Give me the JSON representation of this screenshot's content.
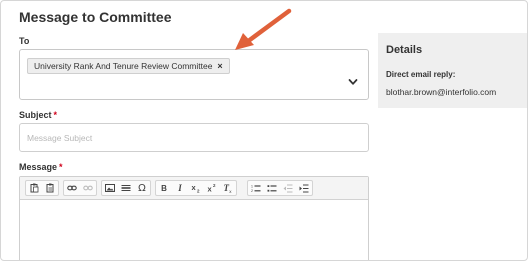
{
  "form": {
    "title": "Message to Committee",
    "to_label": "To",
    "recipient_chip": "University Rank And Tenure Review Committee",
    "chip_remove": "×",
    "subject_label": "Subject",
    "subject_required": "*",
    "subject_placeholder": "Message Subject",
    "message_label": "Message",
    "message_required": "*"
  },
  "toolbar": {
    "omega": "Ω",
    "bold": "B",
    "italic": "I"
  },
  "details": {
    "title": "Details",
    "direct_email_label": "Direct email reply:",
    "direct_email_value": "blothar.brown@interfolio.com"
  },
  "colors": {
    "annotation_arrow": "#e0613a",
    "required": "#d0021b",
    "panel_bg": "#efefef"
  }
}
